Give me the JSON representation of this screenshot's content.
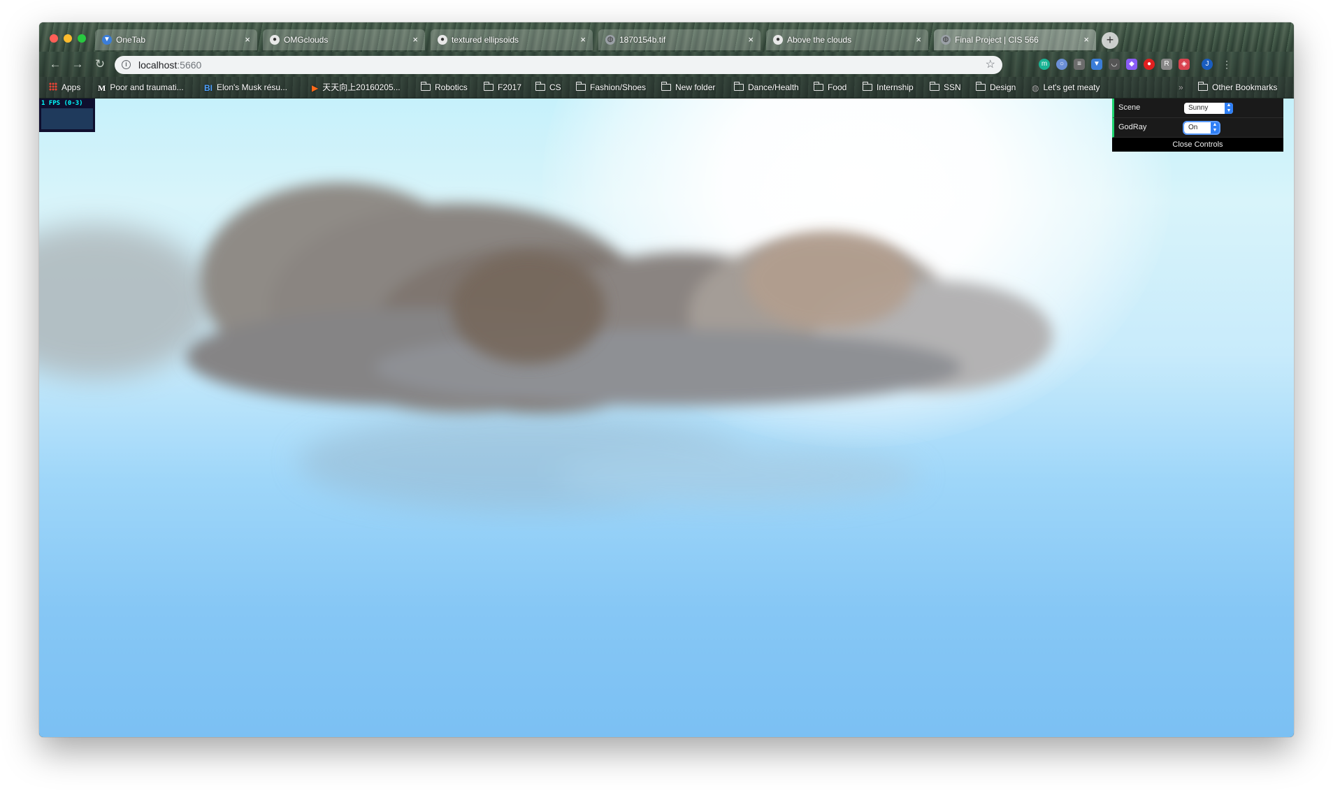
{
  "browser": {
    "tabs": [
      {
        "title": "OneTab",
        "favicon": "onetab-icon",
        "close": "×",
        "active": false
      },
      {
        "title": "OMGclouds",
        "favicon": "github-icon",
        "close": "×",
        "active": false
      },
      {
        "title": "textured ellipsoids",
        "favicon": "github-icon",
        "close": "×",
        "active": false
      },
      {
        "title": "1870154b.tif",
        "favicon": "globe-icon",
        "close": "×",
        "active": false
      },
      {
        "title": "Above the clouds",
        "favicon": "github-icon",
        "close": "×",
        "active": false
      },
      {
        "title": "Final Project | CIS 566",
        "favicon": "globe-icon",
        "close": "×",
        "active": true
      }
    ],
    "new_tab": "+",
    "address": {
      "host": "localhost",
      "port": ":5660"
    },
    "bookmarks": [
      {
        "label": "Apps",
        "icon": "apps-icon"
      },
      {
        "label": "Poor and traumati...",
        "icon": "medium-icon",
        "glyph": "M"
      },
      {
        "label": "Elon's Musk résu...",
        "icon": "bi-icon",
        "glyph": "BI"
      },
      {
        "label": "天天向上20160205...",
        "icon": "video-icon",
        "glyph": "▶"
      },
      {
        "label": "Robotics",
        "icon": "folder-icon"
      },
      {
        "label": "F2017",
        "icon": "folder-icon"
      },
      {
        "label": "CS",
        "icon": "folder-icon"
      },
      {
        "label": "Fashion/Shoes",
        "icon": "folder-icon"
      },
      {
        "label": "New folder",
        "icon": "folder-icon"
      },
      {
        "label": "Dance/Health",
        "icon": "folder-icon"
      },
      {
        "label": "Food",
        "icon": "folder-icon"
      },
      {
        "label": "Internship",
        "icon": "folder-icon"
      },
      {
        "label": "SSN",
        "icon": "folder-icon"
      },
      {
        "label": "Design",
        "icon": "folder-icon"
      },
      {
        "label": "Let's get meaty",
        "icon": "globe-icon"
      }
    ],
    "overflow": "»",
    "other_bookmarks": "Other Bookmarks",
    "profile_initial": "J"
  },
  "app": {
    "stats": {
      "fps_text": "1 FPS (0-3)"
    },
    "controls": {
      "scene": {
        "label": "Scene",
        "value": "Sunny"
      },
      "godray": {
        "label": "GodRay",
        "value": "On"
      },
      "close_label": "Close Controls"
    }
  },
  "colors": {
    "sky_top": "#c6f1fb",
    "sky_bottom": "#7bc0f3",
    "gui_accent": "#1ed36f",
    "select_arrow": "#2f7ff5"
  }
}
